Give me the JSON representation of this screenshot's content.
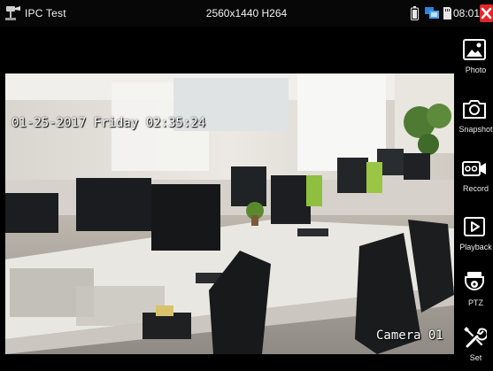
{
  "statusbar": {
    "app_title": "IPC Test",
    "stream_info": "2560x1440 H264",
    "clock": "08:01",
    "icons": [
      "ipc-tester-icon",
      "battery-icon",
      "network-icon",
      "sd-card-icon",
      "close-icon"
    ]
  },
  "video": {
    "osd_timestamp": "01-25-2017 Friday 02:35:24",
    "osd_camera_name": "Camera 01"
  },
  "toolbar": {
    "items": [
      {
        "label": "Photo",
        "icon": "photo-icon"
      },
      {
        "label": "Snapshot",
        "icon": "camera-icon"
      },
      {
        "label": "Record",
        "icon": "record-icon"
      },
      {
        "label": "Playback",
        "icon": "play-icon"
      },
      {
        "label": "PTZ",
        "icon": "ptz-dome-icon"
      },
      {
        "label": "Set",
        "icon": "wrench-icon"
      }
    ]
  },
  "colors": {
    "background": "#000000",
    "close_button": "#e4262a",
    "text": "#ffffff"
  }
}
